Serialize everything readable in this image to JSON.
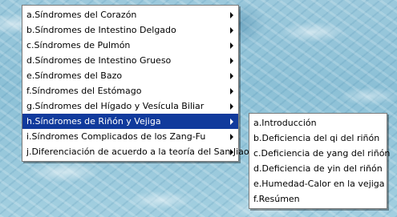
{
  "main_menu": {
    "items": [
      {
        "label": "a.Síndromes del Corazón",
        "has_submenu": true
      },
      {
        "label": "b.Síndromes de Intestino Delgado",
        "has_submenu": true
      },
      {
        "label": "c.Síndromes de Pulmón",
        "has_submenu": true
      },
      {
        "label": "d.Síndromes de Intestino Grueso",
        "has_submenu": true
      },
      {
        "label": "e.Síndromes del Bazo",
        "has_submenu": true
      },
      {
        "label": "f.Síndromes del Estómago",
        "has_submenu": true
      },
      {
        "label": "g.Síndromes del Hígado y Vesícula Biliar",
        "has_submenu": true
      },
      {
        "label": "h.Síndromes de Riñón y Vejiga",
        "has_submenu": true,
        "selected": true
      },
      {
        "label": "i.Síndromes Complicados de los Zang-Fu",
        "has_submenu": true
      },
      {
        "label": "j.Diferenciación de acuerdo a la teoría del San Jiao",
        "has_submenu": true
      }
    ]
  },
  "sub_menu": {
    "items": [
      {
        "label": "a.Introducción"
      },
      {
        "label": "b.Deficiencia del qi del riñón"
      },
      {
        "label": "c.Deficiencia de yang del riñón"
      },
      {
        "label": "d.Deficiencia de yin del riñón"
      },
      {
        "label": "e.Humedad-Calor en la vejiga"
      },
      {
        "label": "f.Resúmen"
      }
    ]
  },
  "colors": {
    "selection_background": "#103a9c",
    "selection_text": "#ffffff",
    "menu_background": "#ffffff",
    "desktop_background": "#9cc9dc"
  }
}
